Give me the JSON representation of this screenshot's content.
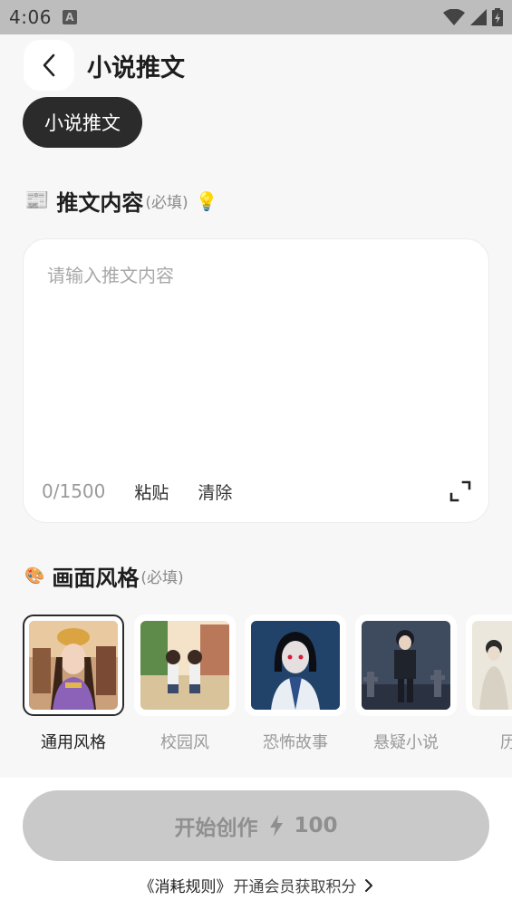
{
  "status_bar": {
    "time": "4:06",
    "notification_letter": "A"
  },
  "header": {
    "title": "小说推文",
    "back_icon": "chevron-left-icon"
  },
  "category_chip": {
    "label": "小说推文"
  },
  "content_section": {
    "emoji": "📰",
    "title": "推文内容",
    "required": "(必填)",
    "hint_emoji": "💡",
    "placeholder": "请输入推文内容",
    "value": "",
    "counter": "0/1500",
    "paste_label": "粘贴",
    "clear_label": "清除"
  },
  "style_section": {
    "emoji": "🎨",
    "title": "画面风格",
    "required": "(必填)",
    "items": [
      {
        "label": "通用风格",
        "selected": true
      },
      {
        "label": "校园风",
        "selected": false
      },
      {
        "label": "恐怖故事",
        "selected": false
      },
      {
        "label": "悬疑小说",
        "selected": false
      },
      {
        "label": "历史",
        "selected": false
      }
    ]
  },
  "footer": {
    "start_label": "开始创作",
    "cost": "100",
    "rules_link": "《消耗规则》",
    "member_text": "开通会员获取积分"
  },
  "colors": {
    "primary_dark": "#2b2b2b",
    "disabled_button": "#c9c9c9",
    "background": "#f7f7f7"
  }
}
